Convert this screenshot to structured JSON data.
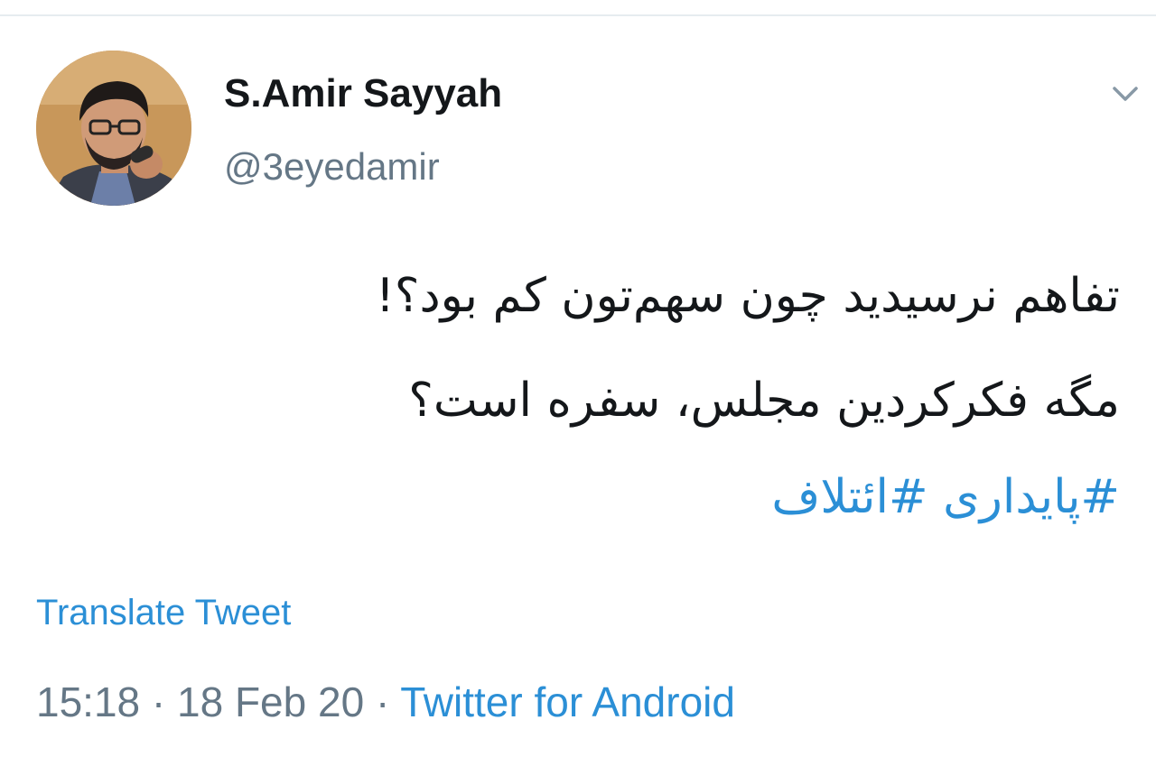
{
  "tweet": {
    "author": {
      "display_name": "S.Amir Sayyah",
      "handle": "@3eyedamir",
      "avatar_icon": "person-avatar"
    },
    "text_lines": [
      "تفاهم نرسیدید چون سهم‌تون کم بود؟!",
      "مگه فکرکردین مجلس، سفره است؟"
    ],
    "hashtags": [
      "#پایداری",
      "#ائتلاف"
    ],
    "translate_label": "Translate Tweet",
    "time": "15:18",
    "separator": "·",
    "date": "18 Feb 20",
    "source": "Twitter for Android",
    "menu_icon": "chevron-down-icon"
  },
  "colors": {
    "link": "#2b8fd6",
    "secondary_text": "#657786",
    "primary_text": "#14171a",
    "divider": "#e6ecf0"
  }
}
